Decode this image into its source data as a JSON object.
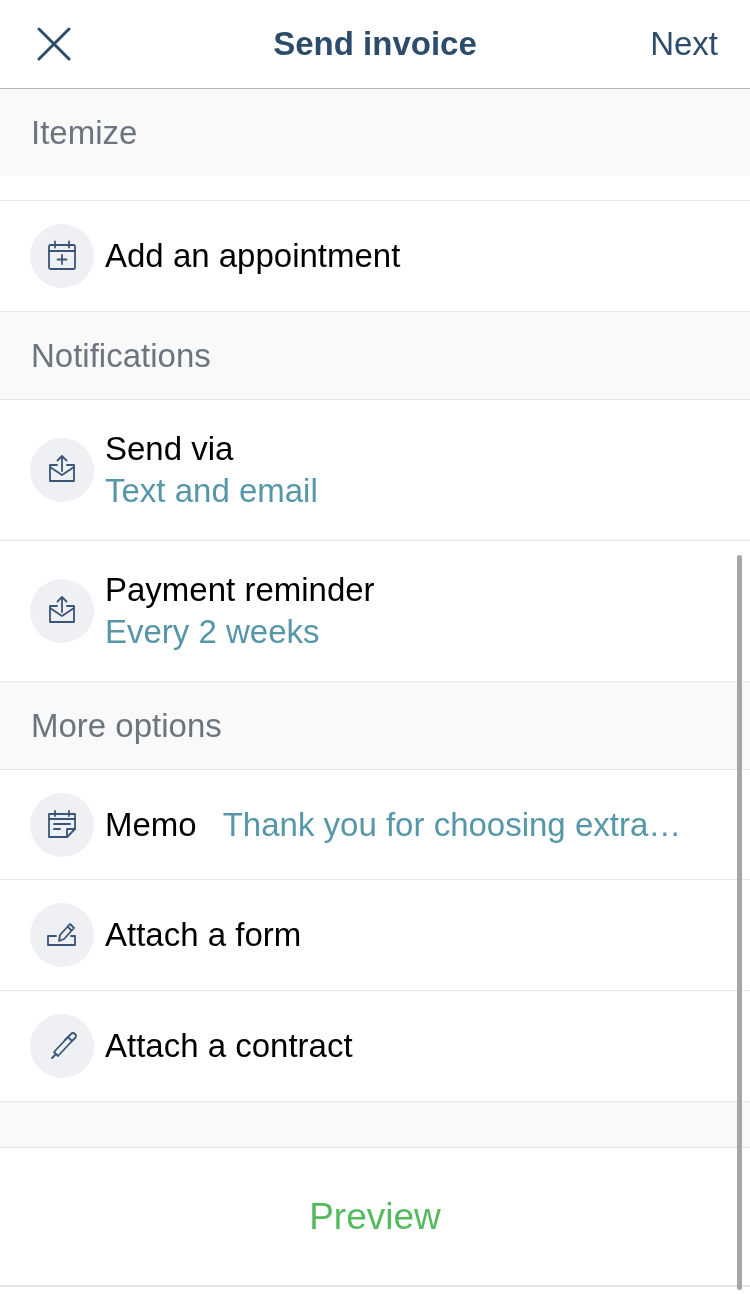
{
  "header": {
    "title": "Send invoice",
    "next": "Next"
  },
  "sections": [
    {
      "title": "Itemize",
      "rows": [
        {
          "kind": "action",
          "title": "Add an appointment"
        }
      ]
    },
    {
      "title": "Notifications",
      "rows": [
        {
          "kind": "setting",
          "title": "Send via",
          "value": "Text and email"
        },
        {
          "kind": "setting",
          "title": "Payment reminder",
          "value": "Every 2 weeks"
        }
      ]
    },
    {
      "title": "More options",
      "rows": [
        {
          "kind": "inline",
          "title": "Memo",
          "value": "Thank you for choosing extra…"
        },
        {
          "kind": "action",
          "title": "Attach a form"
        },
        {
          "kind": "action",
          "title": "Attach a contract"
        }
      ]
    }
  ],
  "footer": {
    "button": "Preview"
  }
}
